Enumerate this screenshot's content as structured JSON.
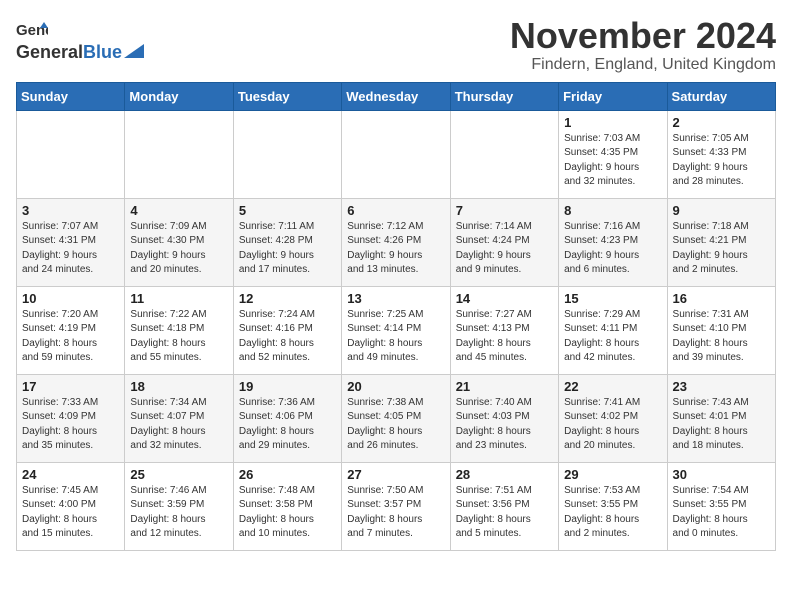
{
  "header": {
    "logo_general": "General",
    "logo_blue": "Blue",
    "month_title": "November 2024",
    "location": "Findern, England, United Kingdom"
  },
  "weekdays": [
    "Sunday",
    "Monday",
    "Tuesday",
    "Wednesday",
    "Thursday",
    "Friday",
    "Saturday"
  ],
  "rows": [
    [
      {
        "day": "",
        "info": ""
      },
      {
        "day": "",
        "info": ""
      },
      {
        "day": "",
        "info": ""
      },
      {
        "day": "",
        "info": ""
      },
      {
        "day": "",
        "info": ""
      },
      {
        "day": "1",
        "info": "Sunrise: 7:03 AM\nSunset: 4:35 PM\nDaylight: 9 hours\nand 32 minutes."
      },
      {
        "day": "2",
        "info": "Sunrise: 7:05 AM\nSunset: 4:33 PM\nDaylight: 9 hours\nand 28 minutes."
      }
    ],
    [
      {
        "day": "3",
        "info": "Sunrise: 7:07 AM\nSunset: 4:31 PM\nDaylight: 9 hours\nand 24 minutes."
      },
      {
        "day": "4",
        "info": "Sunrise: 7:09 AM\nSunset: 4:30 PM\nDaylight: 9 hours\nand 20 minutes."
      },
      {
        "day": "5",
        "info": "Sunrise: 7:11 AM\nSunset: 4:28 PM\nDaylight: 9 hours\nand 17 minutes."
      },
      {
        "day": "6",
        "info": "Sunrise: 7:12 AM\nSunset: 4:26 PM\nDaylight: 9 hours\nand 13 minutes."
      },
      {
        "day": "7",
        "info": "Sunrise: 7:14 AM\nSunset: 4:24 PM\nDaylight: 9 hours\nand 9 minutes."
      },
      {
        "day": "8",
        "info": "Sunrise: 7:16 AM\nSunset: 4:23 PM\nDaylight: 9 hours\nand 6 minutes."
      },
      {
        "day": "9",
        "info": "Sunrise: 7:18 AM\nSunset: 4:21 PM\nDaylight: 9 hours\nand 2 minutes."
      }
    ],
    [
      {
        "day": "10",
        "info": "Sunrise: 7:20 AM\nSunset: 4:19 PM\nDaylight: 8 hours\nand 59 minutes."
      },
      {
        "day": "11",
        "info": "Sunrise: 7:22 AM\nSunset: 4:18 PM\nDaylight: 8 hours\nand 55 minutes."
      },
      {
        "day": "12",
        "info": "Sunrise: 7:24 AM\nSunset: 4:16 PM\nDaylight: 8 hours\nand 52 minutes."
      },
      {
        "day": "13",
        "info": "Sunrise: 7:25 AM\nSunset: 4:14 PM\nDaylight: 8 hours\nand 49 minutes."
      },
      {
        "day": "14",
        "info": "Sunrise: 7:27 AM\nSunset: 4:13 PM\nDaylight: 8 hours\nand 45 minutes."
      },
      {
        "day": "15",
        "info": "Sunrise: 7:29 AM\nSunset: 4:11 PM\nDaylight: 8 hours\nand 42 minutes."
      },
      {
        "day": "16",
        "info": "Sunrise: 7:31 AM\nSunset: 4:10 PM\nDaylight: 8 hours\nand 39 minutes."
      }
    ],
    [
      {
        "day": "17",
        "info": "Sunrise: 7:33 AM\nSunset: 4:09 PM\nDaylight: 8 hours\nand 35 minutes."
      },
      {
        "day": "18",
        "info": "Sunrise: 7:34 AM\nSunset: 4:07 PM\nDaylight: 8 hours\nand 32 minutes."
      },
      {
        "day": "19",
        "info": "Sunrise: 7:36 AM\nSunset: 4:06 PM\nDaylight: 8 hours\nand 29 minutes."
      },
      {
        "day": "20",
        "info": "Sunrise: 7:38 AM\nSunset: 4:05 PM\nDaylight: 8 hours\nand 26 minutes."
      },
      {
        "day": "21",
        "info": "Sunrise: 7:40 AM\nSunset: 4:03 PM\nDaylight: 8 hours\nand 23 minutes."
      },
      {
        "day": "22",
        "info": "Sunrise: 7:41 AM\nSunset: 4:02 PM\nDaylight: 8 hours\nand 20 minutes."
      },
      {
        "day": "23",
        "info": "Sunrise: 7:43 AM\nSunset: 4:01 PM\nDaylight: 8 hours\nand 18 minutes."
      }
    ],
    [
      {
        "day": "24",
        "info": "Sunrise: 7:45 AM\nSunset: 4:00 PM\nDaylight: 8 hours\nand 15 minutes."
      },
      {
        "day": "25",
        "info": "Sunrise: 7:46 AM\nSunset: 3:59 PM\nDaylight: 8 hours\nand 12 minutes."
      },
      {
        "day": "26",
        "info": "Sunrise: 7:48 AM\nSunset: 3:58 PM\nDaylight: 8 hours\nand 10 minutes."
      },
      {
        "day": "27",
        "info": "Sunrise: 7:50 AM\nSunset: 3:57 PM\nDaylight: 8 hours\nand 7 minutes."
      },
      {
        "day": "28",
        "info": "Sunrise: 7:51 AM\nSunset: 3:56 PM\nDaylight: 8 hours\nand 5 minutes."
      },
      {
        "day": "29",
        "info": "Sunrise: 7:53 AM\nSunset: 3:55 PM\nDaylight: 8 hours\nand 2 minutes."
      },
      {
        "day": "30",
        "info": "Sunrise: 7:54 AM\nSunset: 3:55 PM\nDaylight: 8 hours\nand 0 minutes."
      }
    ]
  ]
}
